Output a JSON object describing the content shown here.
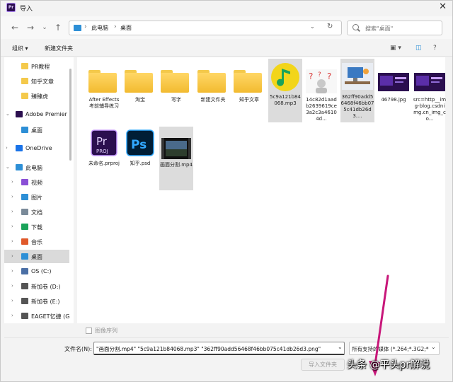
{
  "window": {
    "title": "导入",
    "app_icon_text": "Pr",
    "close_glyph": "✕"
  },
  "nav": {
    "back_glyph": "←",
    "forward_glyph": "→",
    "recent_glyph": "⌄",
    "up_glyph": "↑",
    "breadcrumbs": [
      "此电脑",
      "桌面"
    ],
    "crumb_sep": "›",
    "dropdown_glyph": "⌄",
    "refresh_glyph": "↻",
    "search_placeholder": "搜索\"桌面\""
  },
  "toolbar": {
    "organize": "组织 ▾",
    "new_folder": "新建文件夹",
    "view_glyph": "▣ ▾",
    "pane_glyph": "◫",
    "help_glyph": "?"
  },
  "sidebar": {
    "items": [
      {
        "label": "PR教程",
        "icon": "folder-icon",
        "color": "#f4c94b",
        "chev": ""
      },
      {
        "label": "知乎文章",
        "icon": "folder-icon",
        "color": "#f4c94b",
        "chev": ""
      },
      {
        "label": "臻臻虎",
        "icon": "folder-icon",
        "color": "#f4c94b",
        "chev": ""
      },
      {
        "label": "Adobe Premier",
        "icon": "premiere-icon",
        "color": "#2b0f4f",
        "chev": "⌄"
      },
      {
        "label": "桌面",
        "icon": "desktop-icon",
        "color": "#2d8fd6",
        "chev": ""
      },
      {
        "label": "OneDrive",
        "icon": "cloud-icon",
        "color": "#1a73e8",
        "chev": "›"
      },
      {
        "label": "此电脑",
        "icon": "computer-icon",
        "color": "#2d8fd6",
        "chev": "⌄"
      },
      {
        "label": "视频",
        "icon": "video-icon",
        "color": "#8a4fd6",
        "chev": "›"
      },
      {
        "label": "图片",
        "icon": "picture-icon",
        "color": "#2d8fd6",
        "chev": "›"
      },
      {
        "label": "文档",
        "icon": "document-icon",
        "color": "#7a8a99",
        "chev": "›"
      },
      {
        "label": "下载",
        "icon": "download-icon",
        "color": "#1aa35a",
        "chev": "›"
      },
      {
        "label": "音乐",
        "icon": "music-icon",
        "color": "#e0592a",
        "chev": "›"
      },
      {
        "label": "桌面",
        "icon": "desktop-icon",
        "color": "#2d8fd6",
        "chev": "›"
      },
      {
        "label": "OS (C:)",
        "icon": "drive-icon",
        "color": "#4a6fa5",
        "chev": "›"
      },
      {
        "label": "新加卷 (D:)",
        "icon": "drive-icon",
        "color": "#555555",
        "chev": "›"
      },
      {
        "label": "新加卷 (E:)",
        "icon": "drive-icon",
        "color": "#555555",
        "chev": "›"
      },
      {
        "label": "EAGET忆捷 (G",
        "icon": "drive-icon",
        "color": "#555555",
        "chev": "›"
      }
    ]
  },
  "files": [
    {
      "name": "After Effects考前辅导练习",
      "kind": "folder"
    },
    {
      "name": "淘宝",
      "kind": "folder"
    },
    {
      "name": "写字",
      "kind": "folder"
    },
    {
      "name": "新建文件夹",
      "kind": "folder"
    },
    {
      "name": "知乎文章",
      "kind": "folder"
    },
    {
      "name": "5c9a121b84068.mp3",
      "kind": "qqmusic"
    },
    {
      "name": "14c82d1aadb2639619ce3a2c3a46104d...",
      "kind": "image-question"
    },
    {
      "name": "362ff90add56468f46bb075c41db26d3....",
      "kind": "image-desk"
    },
    {
      "name": "46798.jpg",
      "kind": "image-dark"
    },
    {
      "name": "src=http__img-blog.csdnimg.cn_img_co...",
      "kind": "image-dark"
    },
    {
      "name": "未命名.prproj",
      "kind": "prproj",
      "badge_big": "Pr",
      "badge_small": "PROJ"
    },
    {
      "name": "知乎.psd",
      "kind": "psd",
      "badge_big": "Ps"
    },
    {
      "name": "画面分割.mp4",
      "kind": "video"
    }
  ],
  "footer": {
    "sequence_label": "图像序列",
    "filename_label": "文件名(N):",
    "filename_value": "\"画面分割.mp4\" \"5c9a121b84068.mp3\" \"362ff90add56468f46bb075c41db26d3.png\"",
    "dropdown_glyph": "⌄",
    "filetype_value": "所有支持的媒体 (*.264;*.3G2;*",
    "import_label": "导入文件夹"
  },
  "watermark": "头条 @平头pr解说",
  "colors": {
    "arrow": "#c8177a",
    "selection": "#dcdcdc"
  }
}
